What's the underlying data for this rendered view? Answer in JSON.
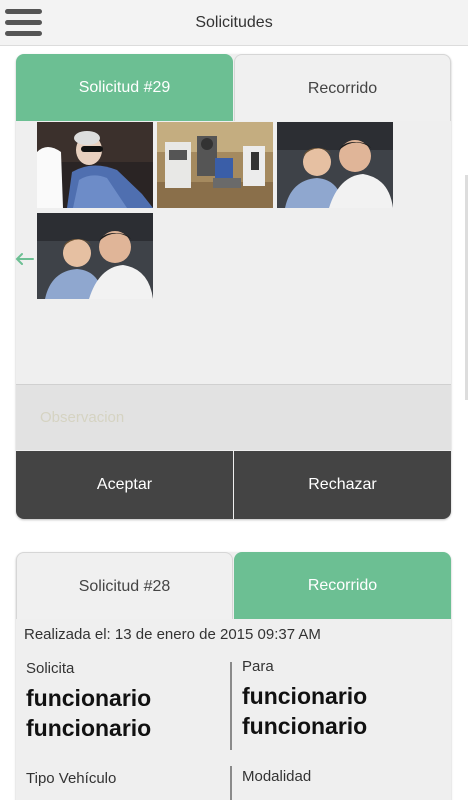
{
  "header": {
    "title": "Solicitudes",
    "menu_icon": "hamburger-menu-icon"
  },
  "card1": {
    "tabs": [
      {
        "label": "Solicitud #29",
        "active": true
      },
      {
        "label": "Recorrido",
        "active": false
      }
    ],
    "photos": [
      "photo-1",
      "photo-2",
      "photo-3",
      "photo-4"
    ],
    "back_icon": "arrow-left-icon",
    "observacion": {
      "value": "",
      "placeholder": "Observacion"
    },
    "buttons": {
      "accept": "Aceptar",
      "reject": "Rechazar"
    }
  },
  "card2": {
    "tabs": [
      {
        "label": "Solicitud #28",
        "active": false
      },
      {
        "label": "Recorrido",
        "active": true
      }
    ],
    "realizada": "Realizada el: 13 de enero de 2015 09:37 AM",
    "solicita_label": "Solicita",
    "solicita_value_1": "funcionario",
    "solicita_value_2": "funcionario",
    "para_label": "Para",
    "para_value_1": "funcionario",
    "para_value_2": "funcionario",
    "tipo_label": "Tipo Vehículo",
    "modalidad_label": "Modalidad"
  },
  "colors": {
    "accent": "#6cbf93",
    "button_bg": "#444444",
    "card_bg": "#efefef"
  }
}
